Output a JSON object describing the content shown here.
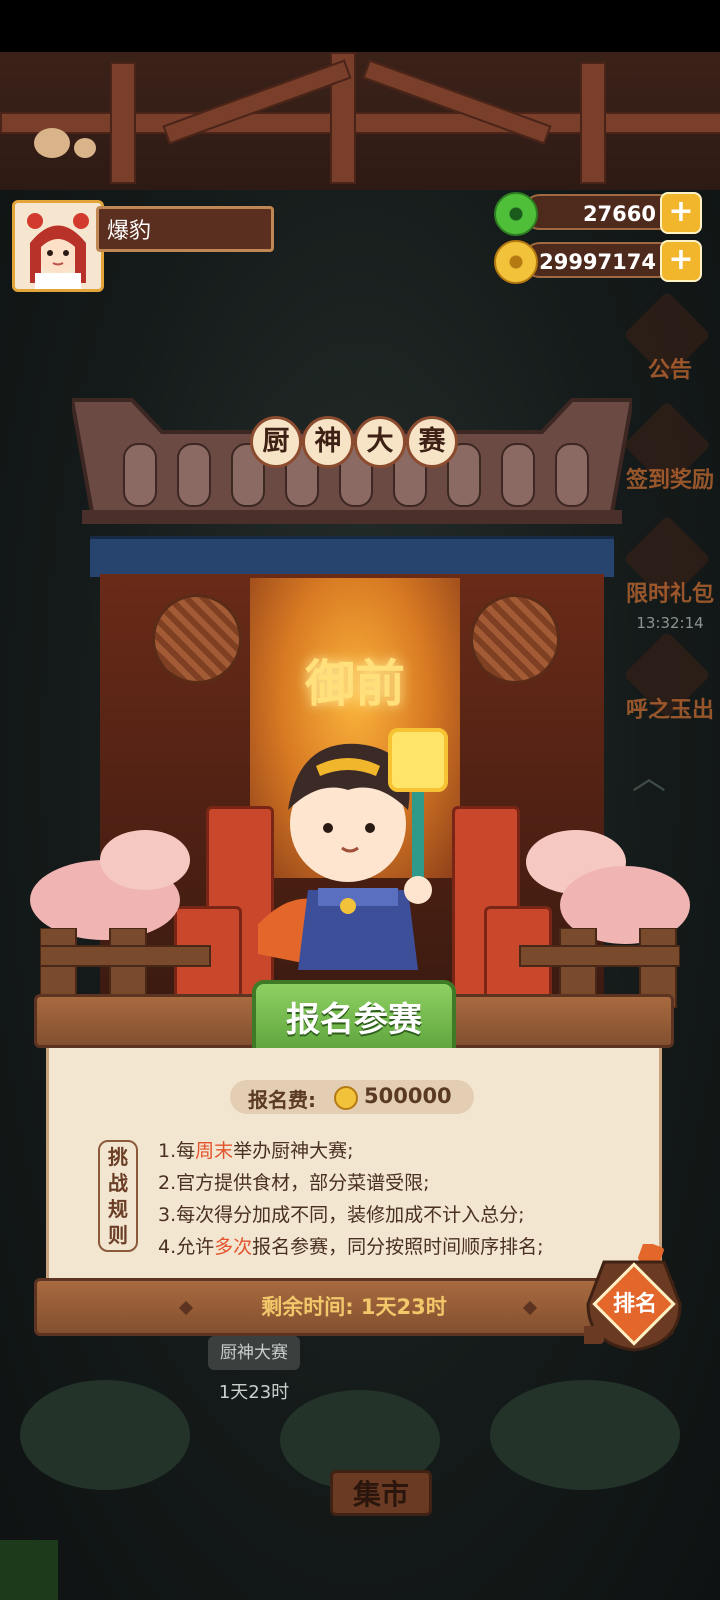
{
  "player": {
    "name": "爆豹"
  },
  "resources": [
    {
      "icon": "jade-icon",
      "value": "27660"
    },
    {
      "icon": "coin-icon",
      "value": "29997174"
    }
  ],
  "side_menu": [
    {
      "icon": "scroll-icon",
      "label": "公告"
    },
    {
      "icon": "gift-icon",
      "label": "签到奖励"
    },
    {
      "icon": "chest-icon",
      "label": "限时礼包",
      "timer": "13:32:14"
    },
    {
      "icon": "eye-icon",
      "label": "呼之玉出"
    }
  ],
  "event": {
    "title_chars": [
      "厨",
      "神",
      "大",
      "赛"
    ],
    "sign_text": "御前",
    "signup_label": "报名参赛",
    "fee_label": "报名费:",
    "fee_value": "500000",
    "rules_tag": "挑战规则",
    "rules": [
      {
        "pre": "1.每",
        "hl": "周末",
        "post": "举办厨神大赛;"
      },
      {
        "pre": "2.官方提供食材，部分菜谱受限;",
        "hl": "",
        "post": ""
      },
      {
        "pre": "3.每次得分加成不同，装修加成不计入总分;",
        "hl": "",
        "post": ""
      },
      {
        "pre": "4.允许",
        "hl": "多次",
        "post": "报名参赛，同分按照时间顺序排名;"
      }
    ],
    "timer_text": "剩余时间: 1天23时",
    "rank_label": "排名"
  },
  "bottom": {
    "event_chip": "厨神大赛",
    "event_timer": "1天23时",
    "market_label": "集市"
  },
  "colors": {
    "accent_green": "#5ca33b",
    "highlight_red": "#e3532d",
    "gold": "#f2b62d"
  }
}
